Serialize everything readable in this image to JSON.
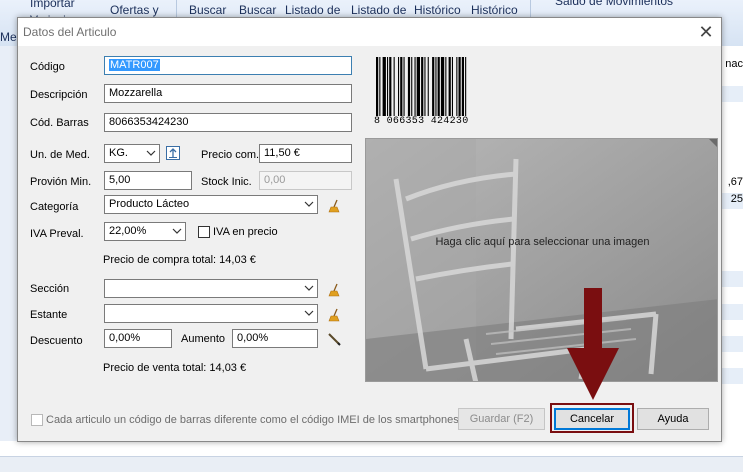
{
  "background": {
    "toolbar_items": [
      "Importar",
      "Variaciones",
      "Ofertas y",
      "Buscar",
      "Buscar",
      "Listado de",
      "Listado de",
      "Histórico",
      "Histórico",
      "Saldo de Movimientos"
    ],
    "side_label": "Me",
    "right_column": [
      "nac",
      "",
      "",
      ",67",
      "25",
      "",
      "",
      "",
      "",
      "",
      "",
      "",
      "",
      "",
      "",
      "",
      "",
      ""
    ]
  },
  "dialog": {
    "title": "Datos del Articulo",
    "fields": {
      "codigo": {
        "label": "Código",
        "value": "MATR007"
      },
      "descripcion": {
        "label": "Descripción",
        "value": "Mozzarella"
      },
      "cod_barras": {
        "label": "Cód. Barras",
        "value": "8066353424230"
      },
      "un_med": {
        "label": "Un. de Med.",
        "value": "KG."
      },
      "precio_com": {
        "label": "Precio com.",
        "value": "11,50 €"
      },
      "provision_min": {
        "label": "Provión Min.",
        "value": "5,00"
      },
      "stock_inic": {
        "label": "Stock Inic.",
        "value": "0,00"
      },
      "categoria": {
        "label": "Categoría",
        "value": "Producto Lácteo"
      },
      "iva_preval": {
        "label": "IVA Preval.",
        "value": "22,00%"
      },
      "iva_en_precio": {
        "label": "IVA en precio",
        "checked": false
      },
      "precio_compra_total": {
        "label": "Precio de compra total: 14,03 €"
      },
      "seccion": {
        "label": "Sección",
        "value": ""
      },
      "estante": {
        "label": "Estante",
        "value": ""
      },
      "descuento": {
        "label": "Descuento",
        "value": "0,00%"
      },
      "aumento": {
        "label": "Aumento",
        "value": "0,00%"
      },
      "precio_venta_total": {
        "label": "Precio de venta total: 14,03 €"
      }
    },
    "barcode": {
      "digits": "8 066353 424230"
    },
    "image_hint": "Haga clic aquí para seleccionar una imagen",
    "imei_checkbox": {
      "label": "Cada articulo un código de barras diferente como el código IMEI de los smartphones",
      "checked": false
    },
    "buttons": {
      "guardar": "Guardar (F2)",
      "cancelar": "Cancelar",
      "ayuda": "Ayuda"
    },
    "close_label": "✕"
  },
  "colors": {
    "annotation": "#7a0e10",
    "selection": "#3399ff",
    "focus": "#0078d7"
  },
  "icons": [
    "chevron-down-icon",
    "upload-icon",
    "broom-icon",
    "pencil-icon",
    "close-icon",
    "barcode-icon",
    "arrow-down-icon"
  ]
}
